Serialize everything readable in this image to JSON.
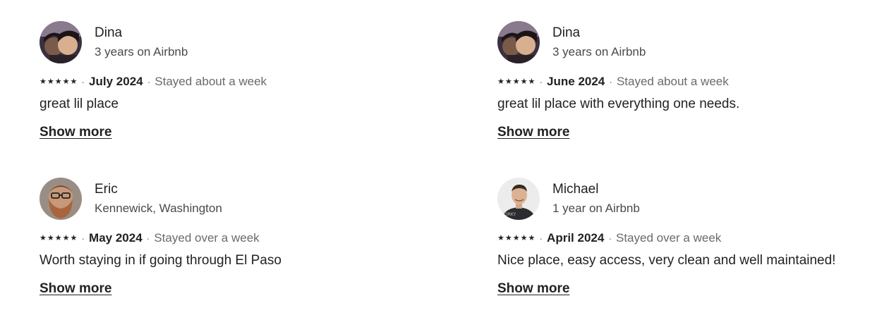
{
  "reviews": [
    {
      "name": "Dina",
      "subtitle": "3 years on Airbnb",
      "rating": 5,
      "date": "July 2024",
      "stay": "Stayed about a week",
      "text": "great lil place",
      "show_more": "Show more",
      "avatar": "dina-avatar"
    },
    {
      "name": "Dina",
      "subtitle": "3 years on Airbnb",
      "rating": 5,
      "date": "June 2024",
      "stay": "Stayed about a week",
      "text": "great lil place with everything one needs.",
      "show_more": "Show more",
      "avatar": "dina-avatar"
    },
    {
      "name": "Eric",
      "subtitle": "Kennewick, Washington",
      "rating": 5,
      "date": "May 2024",
      "stay": "Stayed over a week",
      "text": "Worth staying in if going through El Paso",
      "show_more": "Show more",
      "avatar": "eric-avatar"
    },
    {
      "name": "Michael",
      "subtitle": "1 year on Airbnb",
      "rating": 5,
      "date": "April 2024",
      "stay": "Stayed over a week",
      "text": "Nice place, easy access, very clean and well maintained!",
      "show_more": "Show more",
      "avatar": "michael-avatar"
    }
  ],
  "separator": "·",
  "star_glyph": "★"
}
